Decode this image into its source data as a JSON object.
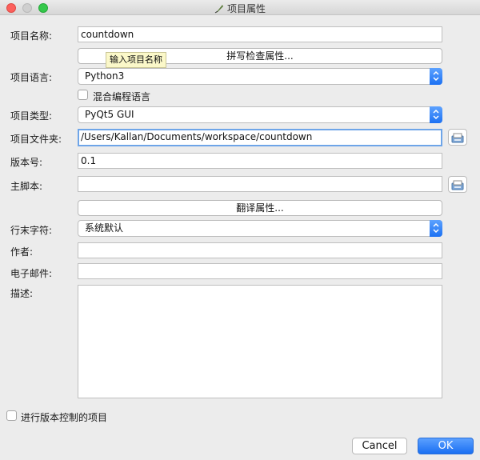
{
  "window": {
    "title": "项目属性",
    "title_icon": "feather-icon"
  },
  "fields": {
    "name_label": "项目名称:",
    "name_value": "countdown",
    "name_tooltip": "输入项目名称",
    "spell_button": "拼写检查属性...",
    "language_label": "项目语言:",
    "language_value": "Python3",
    "mixed_label": "混合编程语言",
    "type_label": "项目类型:",
    "type_value": "PyQt5 GUI",
    "folder_label": "项目文件夹:",
    "folder_value": "/Users/Kallan/Documents/workspace/countdown",
    "version_label": "版本号:",
    "version_value": "0.1",
    "mainscript_label": "主脚本:",
    "mainscript_value": "",
    "translate_button": "翻译属性...",
    "eol_label": "行末字符:",
    "eol_value": "系统默认",
    "author_label": "作者:",
    "author_value": "",
    "email_label": "电子邮件:",
    "email_value": "",
    "desc_label": "描述:",
    "desc_value": "",
    "vcs_label": "进行版本控制的项目"
  },
  "buttons": {
    "cancel": "Cancel",
    "ok": "OK"
  },
  "colors": {
    "accent": "#1c71f3",
    "focus_ring": "#6ea5e8",
    "tooltip_bg": "#fbf8c9"
  }
}
